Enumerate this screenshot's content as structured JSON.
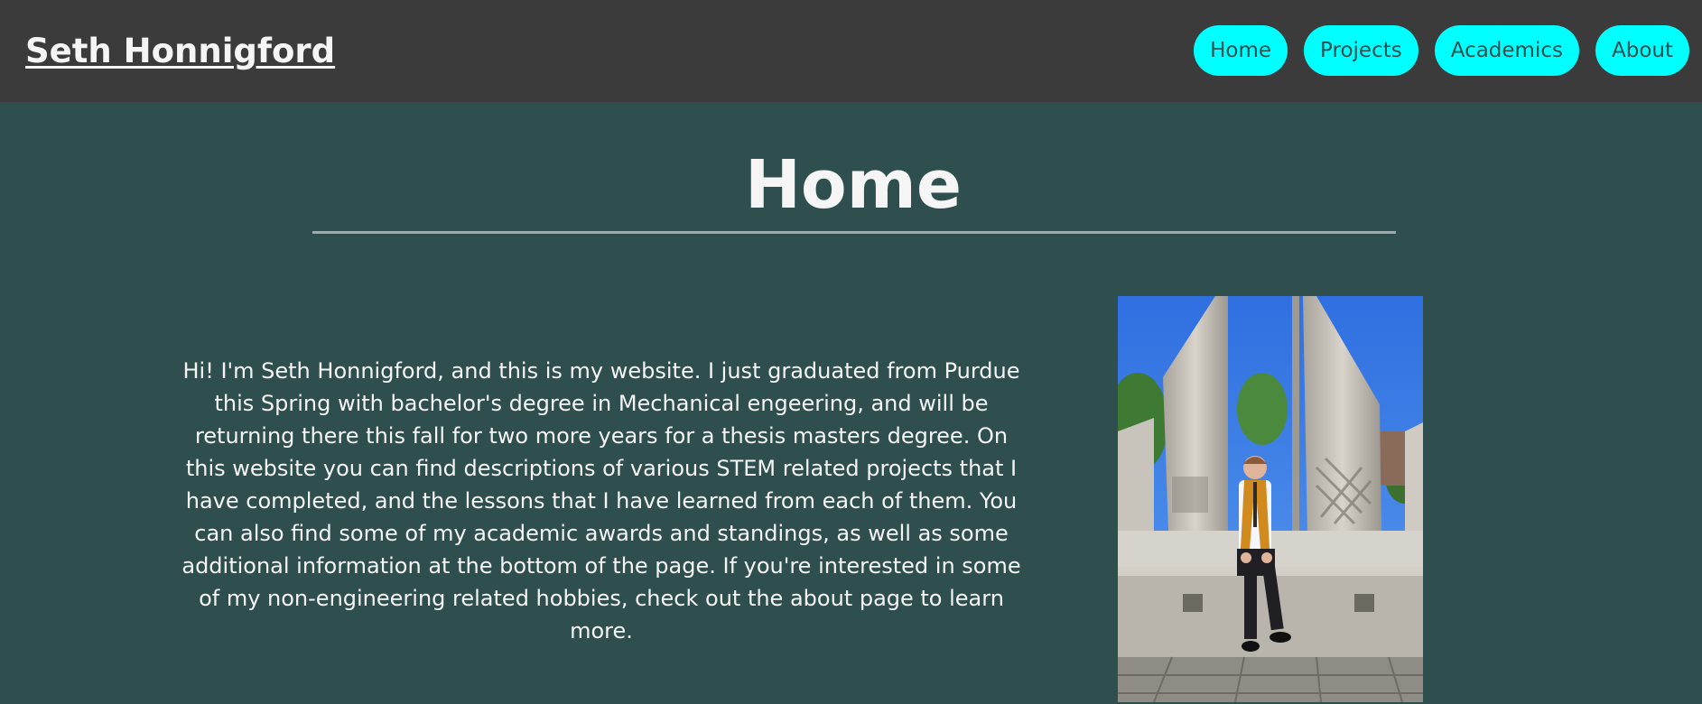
{
  "header": {
    "site_title": "Seth Honnigford",
    "nav": [
      {
        "label": "Home"
      },
      {
        "label": "Projects"
      },
      {
        "label": "Academics"
      },
      {
        "label": "About"
      }
    ]
  },
  "main": {
    "title": "Home",
    "intro": "Hi! I'm Seth Honnigford, and this is my website. I just graduated from Purdue this Spring with bachelor's degree in Mechanical engeering, and will be returning there this fall for two more years for a thesis masters degree. On this website you can find descriptions of various STEM related projects that I have completed, and the lessons that I have learned from each of them. You can also find some of my academic awards and standings, as well as some additional information at the bottom of the page. If you're interested in some of my non-engineering related hobbies, check out the about page to learn more."
  },
  "colors": {
    "header_bg": "#3b3b3b",
    "page_bg": "#2f4f4f",
    "nav_button_bg": "#00ffff",
    "nav_button_text": "#2f4f4f",
    "text": "#f5f5f5"
  }
}
